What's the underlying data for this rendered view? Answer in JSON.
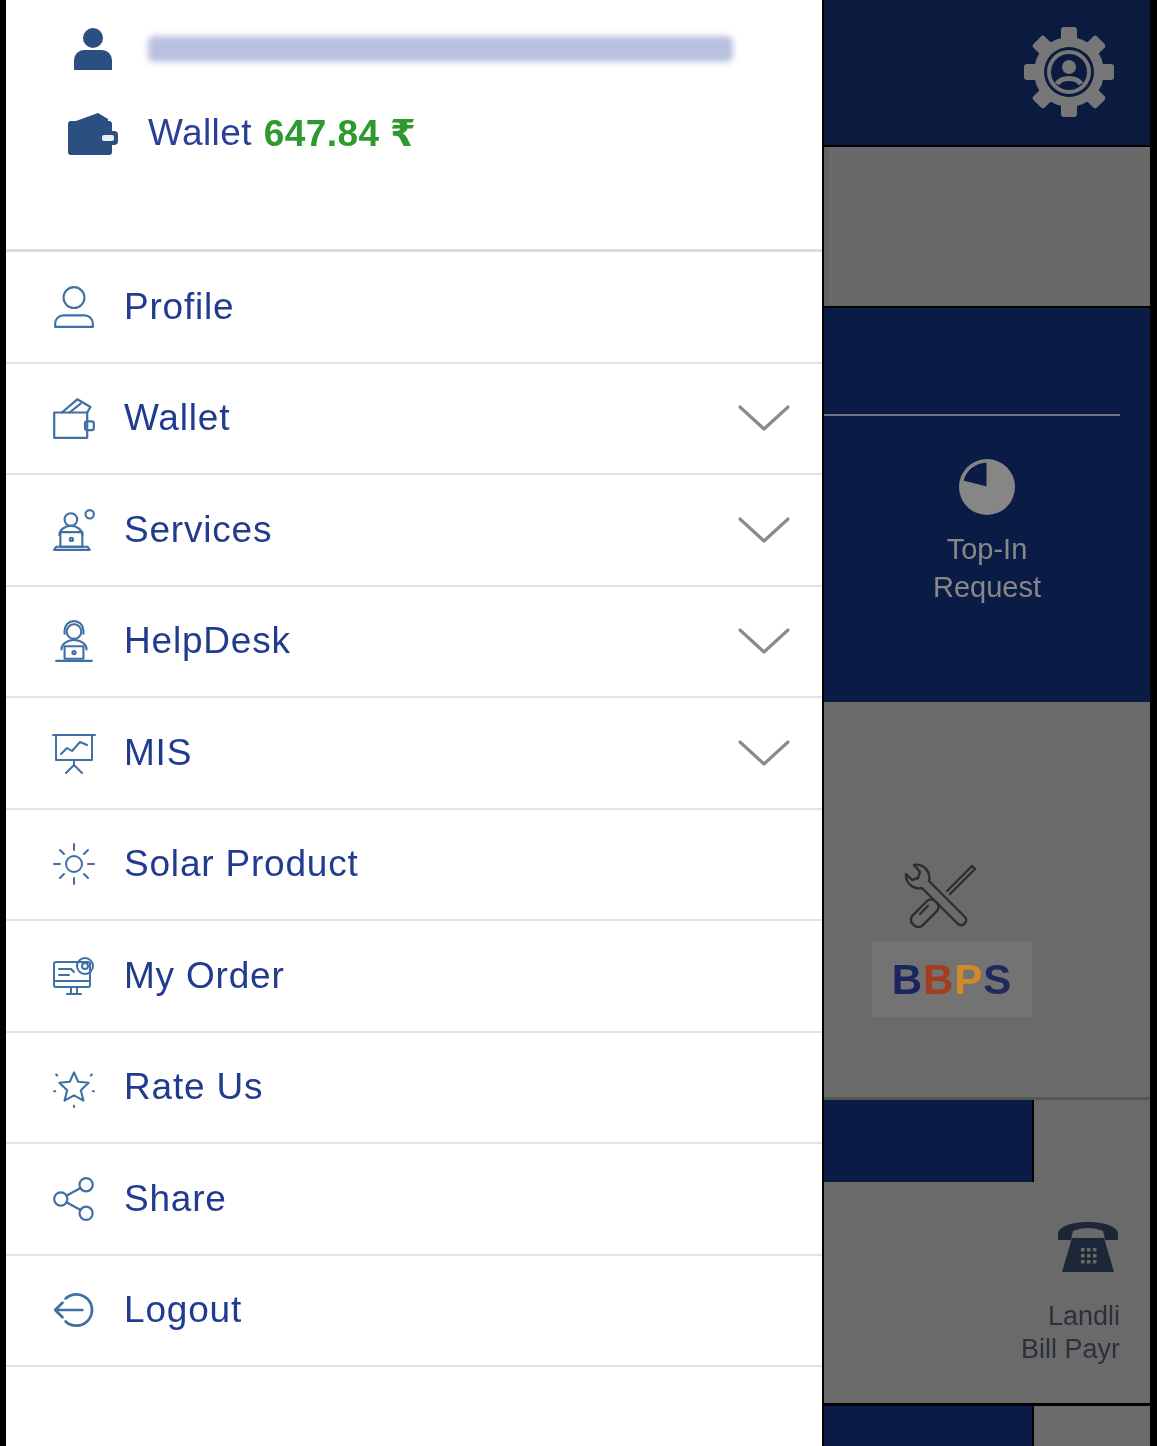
{
  "drawer": {
    "header": {
      "wallet_label": "Wallet",
      "wallet_amount": "647.84 ₹"
    },
    "menu": [
      {
        "label": "Profile",
        "has_submenu": false
      },
      {
        "label": "Wallet",
        "has_submenu": true
      },
      {
        "label": "Services",
        "has_submenu": true
      },
      {
        "label": "HelpDesk",
        "has_submenu": true
      },
      {
        "label": "MIS",
        "has_submenu": true
      },
      {
        "label": "Solar Product",
        "has_submenu": false
      },
      {
        "label": "My Order",
        "has_submenu": false
      },
      {
        "label": "Rate Us",
        "has_submenu": false
      },
      {
        "label": "Share",
        "has_submenu": false
      },
      {
        "label": "Logout",
        "has_submenu": false
      }
    ]
  },
  "background_screen": {
    "top_in_tile": {
      "label": "Top-In\nRequest"
    },
    "bbps_tile": {
      "logo_text": "BBPS"
    },
    "landline_tile": {
      "label": "Landli\nBill Payr"
    }
  }
}
